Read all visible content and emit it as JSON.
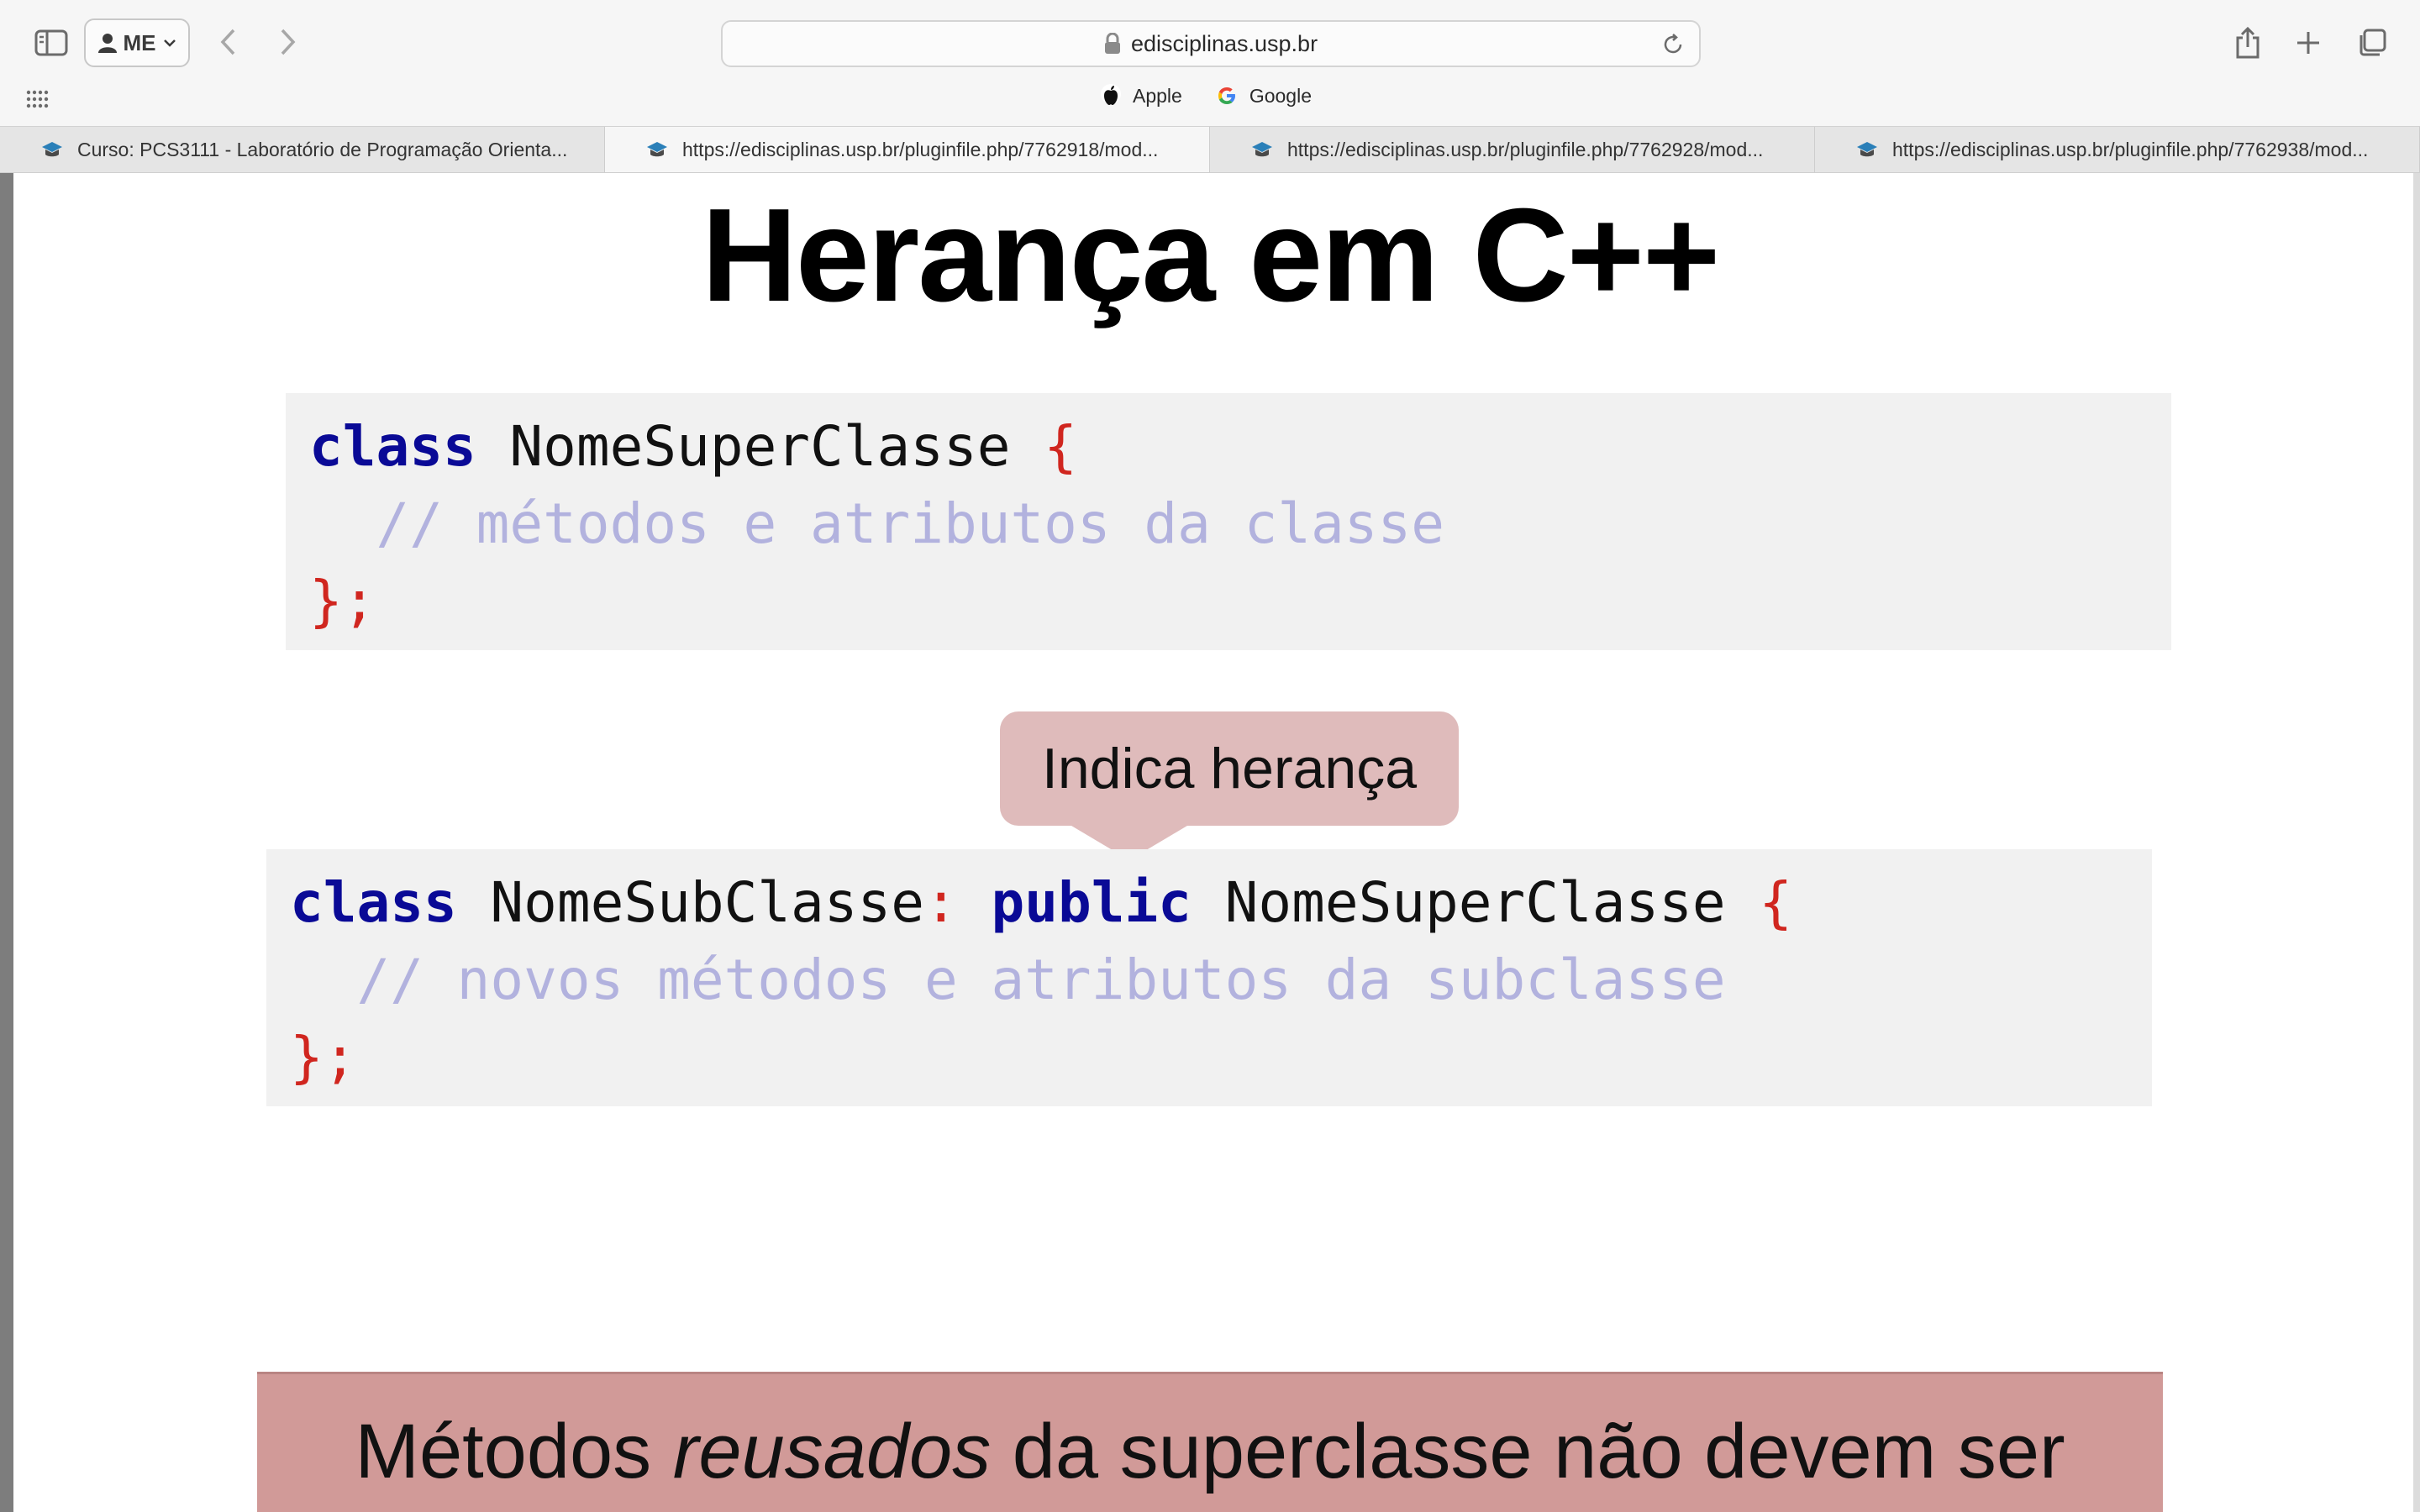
{
  "browser": {
    "profile_label": "ME",
    "address": "edisciplinas.usp.br",
    "bookmarks": [
      {
        "label": "Apple",
        "icon": "apple-logo-icon"
      },
      {
        "label": "Google",
        "icon": "google-logo-icon"
      }
    ],
    "tabs": [
      {
        "title": "Curso: PCS3111 - Laboratório de Programação Orienta...",
        "active": false
      },
      {
        "title": "https://edisciplinas.usp.br/pluginfile.php/7762918/mod...",
        "active": true
      },
      {
        "title": "https://edisciplinas.usp.br/pluginfile.php/7762928/mod...",
        "active": false
      },
      {
        "title": "https://edisciplinas.usp.br/pluginfile.php/7762938/mod...",
        "active": false
      }
    ]
  },
  "slide": {
    "title": "Herança em C++",
    "code1": {
      "line1_keyword": "class",
      "line1_name": " NomeSuperClasse ",
      "line1_brace": "{",
      "line2_comment": "  // métodos e atributos da classe",
      "line3_close": "};"
    },
    "callout": "Indica herança",
    "code2": {
      "line1_keyword": "class",
      "line1_name": " NomeSubClasse",
      "line1_colon": ":",
      "line1_space": " ",
      "line1_keyword2": "public",
      "line1_base": " NomeSuperClasse ",
      "line1_brace": "{",
      "line2_comment": "  // novos métodos e atributos da subclasse",
      "line3_close": "};"
    },
    "banner": {
      "before": "Métodos ",
      "emphasis": "reusados",
      "after": " da superclasse não devem ser"
    }
  },
  "colors": {
    "keyword": "#0a0a96",
    "brace": "#d0261f",
    "comment": "#b2b2de",
    "callout_bg": "#dfbbbb",
    "banner_bg": "#d19a98",
    "code_bg": "#f1f1f1"
  }
}
